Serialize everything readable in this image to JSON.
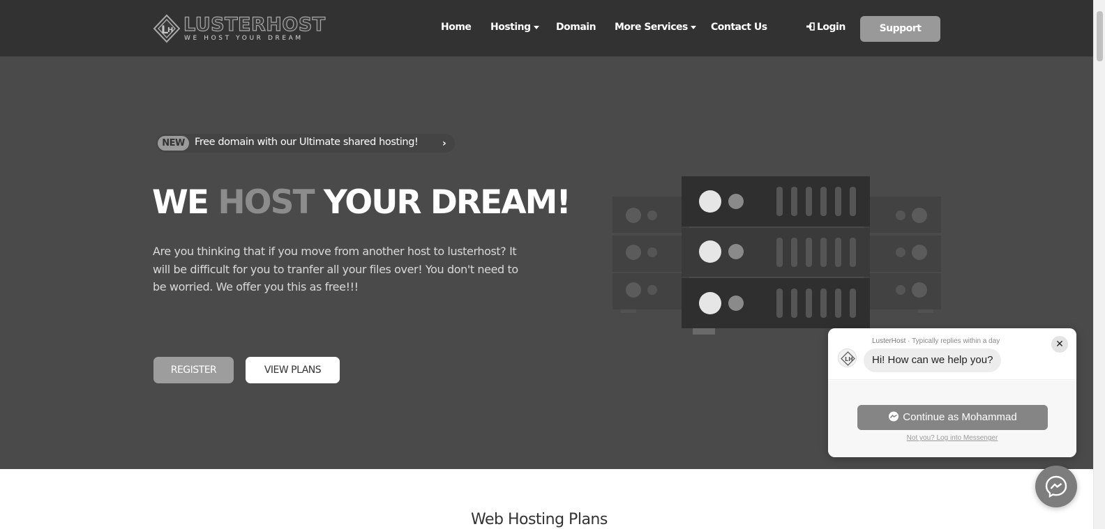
{
  "brand": {
    "name": "LUSTERHOST",
    "tagline": "WE HOST YOUR DREAM"
  },
  "nav": {
    "items": [
      {
        "label": "Home",
        "has_dropdown": false
      },
      {
        "label": "Hosting",
        "has_dropdown": true
      },
      {
        "label": "Domain",
        "has_dropdown": false
      },
      {
        "label": "More Services",
        "has_dropdown": true
      },
      {
        "label": "Contact Us",
        "has_dropdown": false
      }
    ],
    "login_label": "Login",
    "support_label": "Support"
  },
  "hero": {
    "badge": "NEW",
    "announcement": "Free domain with our Ultimate shared hosting!",
    "headline_part1": "WE ",
    "headline_accent": "HOST",
    "headline_part2": " YOUR DREAM!",
    "description": "Are you thinking that if you move from another host to lusterhost? It will be difficult for you to tranfer all your files over! You don't need to be worried. We offer you this as free!!!",
    "register_label": "REGISTER",
    "view_plans_label": "VIEW PLANS"
  },
  "section": {
    "title": "Web Hosting Plans"
  },
  "chat": {
    "page_name": "LusterHost",
    "reply_time": "Typically replies within a day",
    "greeting": "Hi! How can we help you?",
    "continue_label": "Continue as Mohammad",
    "not_you_label": "Not you? Log into Messenger"
  },
  "colors": {
    "header_bg": "#323232",
    "hero_bg": "#4a4a4a",
    "accent_gray": "#999999"
  }
}
